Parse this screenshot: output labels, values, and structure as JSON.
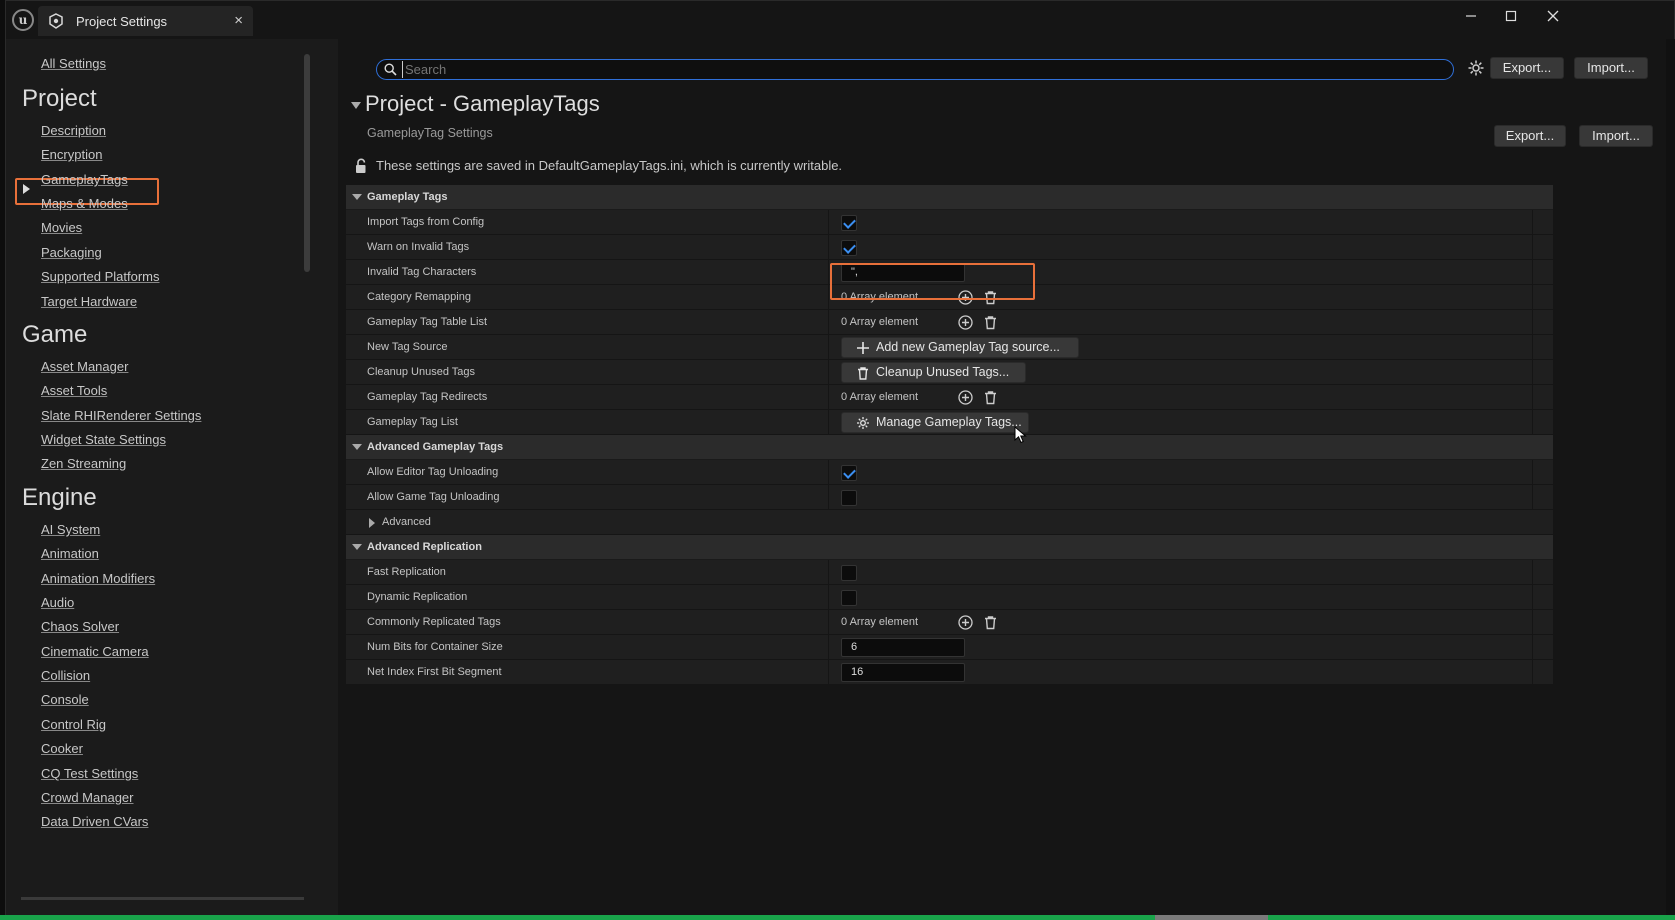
{
  "window": {
    "tab_title": "Project Settings",
    "close_glyph": "×",
    "minimize_glyph": "—",
    "maximize_glyph": "☐",
    "window_close_glyph": "✕",
    "accent_color": "#e8703a",
    "focus_color": "#2f6fd8"
  },
  "sidebar": {
    "all_settings": "All Settings",
    "sections": [
      {
        "heading": "Project",
        "items": [
          "Description",
          "Encryption",
          "GameplayTags",
          "Maps & Modes",
          "Movies",
          "Packaging",
          "Supported Platforms",
          "Target Hardware"
        ]
      },
      {
        "heading": "Game",
        "items": [
          "Asset Manager",
          "Asset Tools",
          "Slate RHIRenderer Settings",
          "Widget State Settings",
          "Zen Streaming"
        ]
      },
      {
        "heading": "Engine",
        "items": [
          "AI System",
          "Animation",
          "Animation Modifiers",
          "Audio",
          "Chaos Solver",
          "Cinematic Camera",
          "Collision",
          "Console",
          "Control Rig",
          "Cooker",
          "CQ Test Settings",
          "Crowd Manager",
          "Data Driven CVars"
        ]
      }
    ],
    "selected_item": "GameplayTags"
  },
  "toolbar": {
    "search_placeholder": "Search",
    "export_label": "Export...",
    "import_label": "Import..."
  },
  "section": {
    "title": "Project - GameplayTags",
    "subtitle": "GameplayTag Settings",
    "export_label": "Export...",
    "import_label": "Import...",
    "writable_notice": "These settings are saved in DefaultGameplayTags.ini, which is currently writable."
  },
  "categories": {
    "gameplay_tags": {
      "label": "Gameplay Tags",
      "import_tags": {
        "name": "Import Tags from Config",
        "checked": true
      },
      "warn_invalid": {
        "name": "Warn on Invalid Tags",
        "checked": true
      },
      "invalid_chars": {
        "name": "Invalid Tag Characters",
        "value": "\",",
        "value_display": "\","
      },
      "category_remap": {
        "name": "Category Remapping",
        "value": "0 Array element"
      },
      "table_list": {
        "name": "Gameplay Tag Table List",
        "value": "0 Array element"
      },
      "new_source": {
        "name": "New Tag Source",
        "button": "Add new Gameplay Tag source..."
      },
      "cleanup": {
        "name": "Cleanup Unused Tags",
        "button": "Cleanup Unused Tags..."
      },
      "redirects": {
        "name": "Gameplay Tag Redirects",
        "value": "0 Array element"
      },
      "tag_list": {
        "name": "Gameplay Tag List",
        "button": "Manage Gameplay Tags..."
      }
    },
    "advanced_gameplay_tags": {
      "label": "Advanced Gameplay Tags",
      "editor_unload": {
        "name": "Allow Editor Tag Unloading",
        "checked": true
      },
      "game_unload": {
        "name": "Allow Game Tag Unloading",
        "checked": false
      },
      "advanced": {
        "name": "Advanced"
      }
    },
    "advanced_replication": {
      "label": "Advanced Replication",
      "fast_rep": {
        "name": "Fast Replication",
        "checked": false
      },
      "dynamic_rep": {
        "name": "Dynamic Replication",
        "checked": false
      },
      "common_tags": {
        "name": "Commonly Replicated Tags",
        "value": "0 Array element"
      },
      "num_bits": {
        "name": "Num Bits for Container Size",
        "value": "6"
      },
      "net_index": {
        "name": "Net Index First Bit Segment",
        "value": "16"
      }
    }
  }
}
